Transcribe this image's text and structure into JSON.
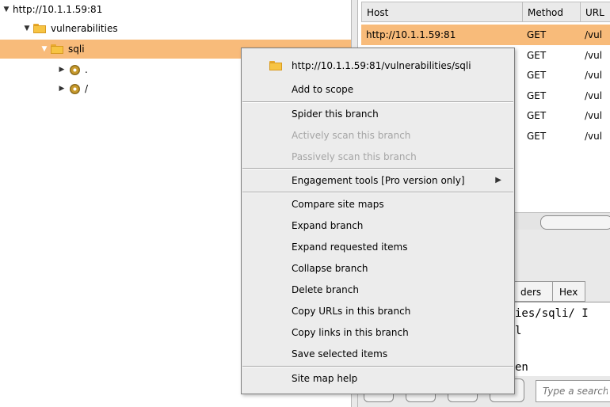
{
  "tree": {
    "root": {
      "label": "http://10.1.1.59:81",
      "expanded": true
    },
    "child": {
      "label": "vulnerabilities",
      "expanded": true
    },
    "selected": {
      "label": "sqli",
      "expanded": true
    },
    "leaves": [
      {
        "label": "."
      },
      {
        "label": "/"
      }
    ]
  },
  "table": {
    "columns": [
      "Host",
      "Method",
      "URL"
    ],
    "rows": [
      {
        "host": "http://10.1.1.59:81",
        "method": "GET",
        "url": "/vul",
        "selected": true
      },
      {
        "host": "",
        "method": "GET",
        "url": "/vul"
      },
      {
        "host": "",
        "method": "GET",
        "url": "/vul"
      },
      {
        "host": "",
        "method": "GET",
        "url": "/vul"
      },
      {
        "host": "",
        "method": "GET",
        "url": "/vul"
      },
      {
        "host": "",
        "method": "GET",
        "url": "/vul"
      }
    ]
  },
  "editor": {
    "tabs": [
      "ders",
      "Hex"
    ],
    "lines": [
      "ies/sqli/ I",
      "l",
      "",
      "en"
    ],
    "search_placeholder": "Type a search"
  },
  "context_menu": {
    "header": "http://10.1.1.59:81/vulnerabilities/sqli",
    "add_to_scope": "Add to scope",
    "spider": "Spider this branch",
    "active_scan": "Actively scan this branch",
    "passive_scan": "Passively scan this branch",
    "engagement": "Engagement tools [Pro version only]",
    "compare": "Compare site maps",
    "expand_branch": "Expand branch",
    "expand_requested": "Expand requested items",
    "collapse": "Collapse branch",
    "delete": "Delete branch",
    "copy_urls": "Copy URLs in this branch",
    "copy_links": "Copy links in this branch",
    "save_items": "Save selected items",
    "help": "Site map help",
    "disabled": [
      "Actively scan this branch",
      "Passively scan this branch"
    ]
  },
  "colors": {
    "selection": "#f8bb7a",
    "folder": "#f7c443",
    "menu_bg": "#ececec"
  }
}
